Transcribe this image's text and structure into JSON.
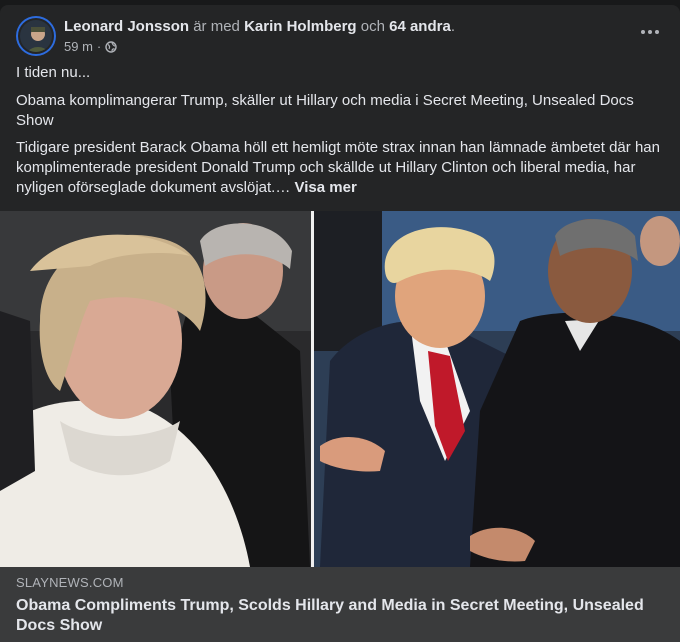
{
  "post": {
    "author": "Leonard Jonsson",
    "with_text": "är med",
    "tagged": "Karin Holmberg",
    "and_text": "och",
    "others": "64 andra",
    "period": ".",
    "time": "59 m",
    "separator": "·",
    "privacy_icon": "globe-icon",
    "more_icon": "more-options-icon"
  },
  "body": {
    "line1": "I tiden nu...",
    "line2": "Obama komplimangerar Trump, skäller ut Hillary och media i Secret Meeting, Unsealed Docs Show",
    "line3": "Tidigare president Barack Obama höll ett hemligt möte strax innan han lämnade ämbetet där han komplimenterade president Donald Trump och skällde ut Hillary Clinton och liberal media, har nyligen oförseglade dokument avslöjat.…",
    "see_more": "Visa mer"
  },
  "link": {
    "domain": "SLAYNEWS.COM",
    "title": "Obama Compliments Trump, Scolds Hillary and Media in Secret Meeting, Unsealed Docs Show"
  },
  "colors": {
    "card": "#242526",
    "text": "#e4e6eb",
    "secondary": "#b0b3b8",
    "link_box": "#3a3b3c"
  }
}
